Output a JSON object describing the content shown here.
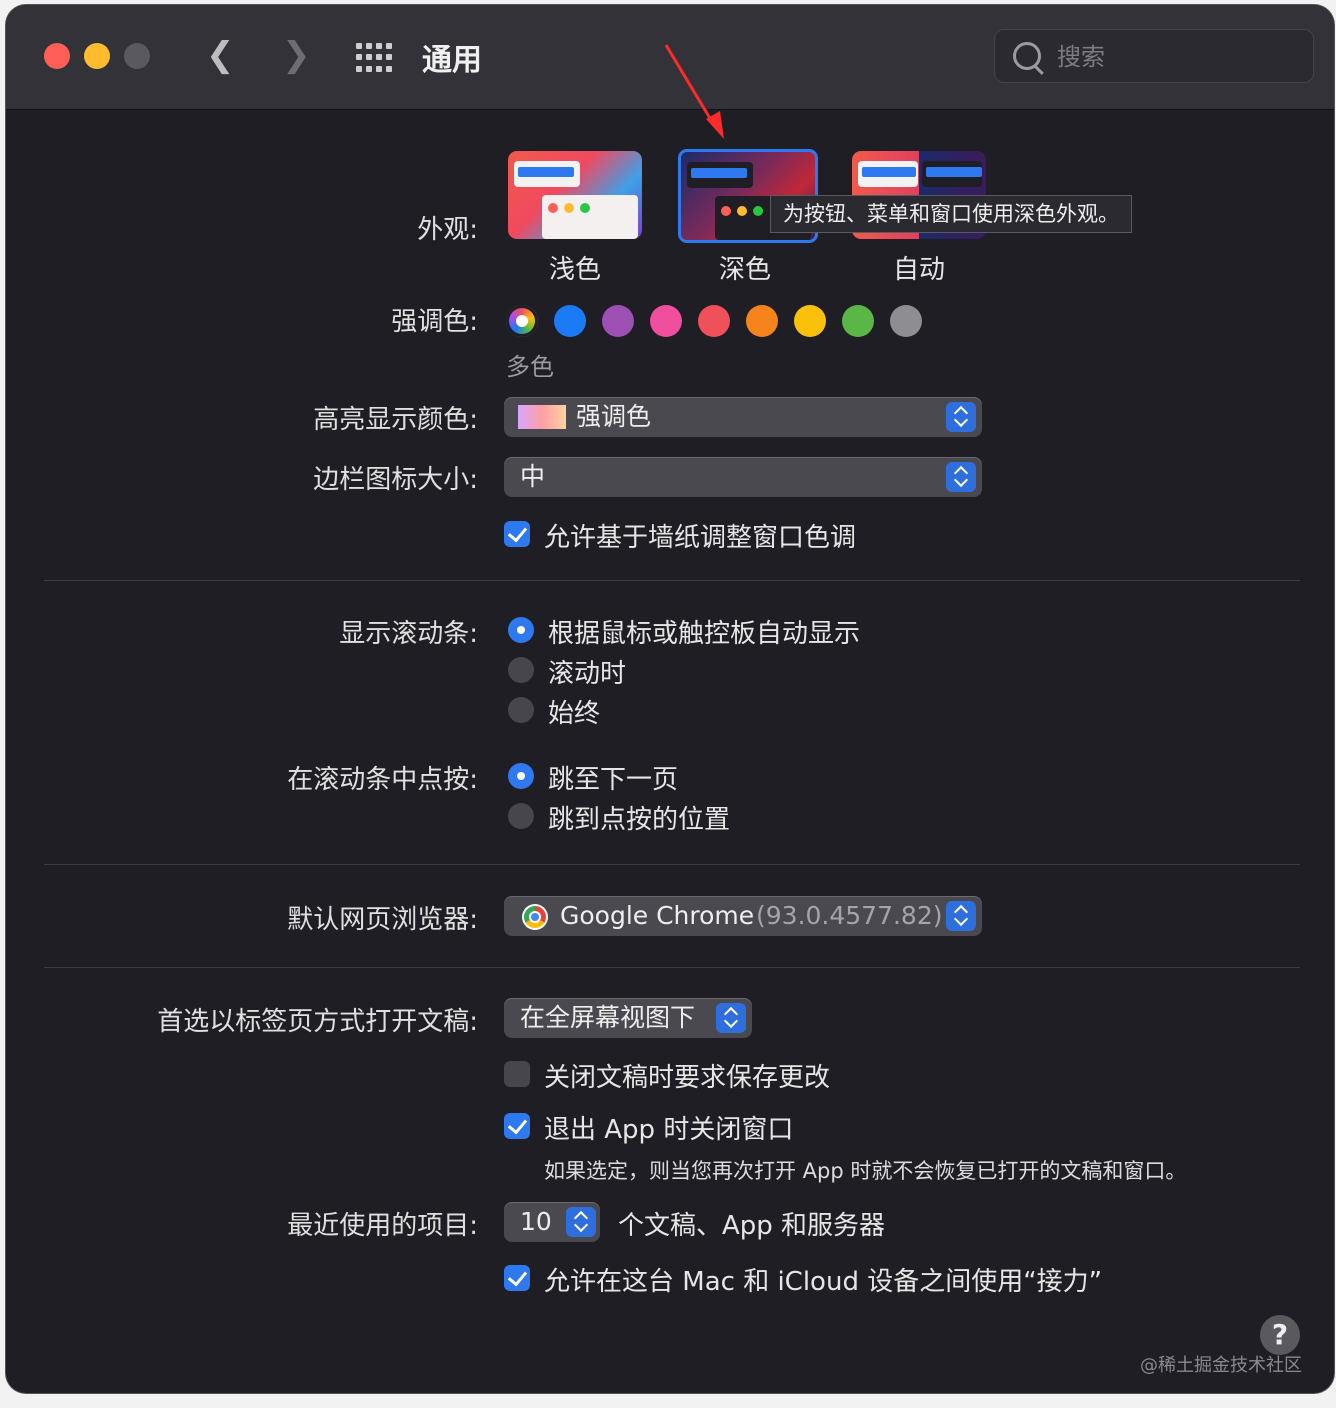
{
  "window": {
    "title": "通用",
    "search_placeholder": "搜索"
  },
  "appearance": {
    "label": "外观:",
    "options": [
      "浅色",
      "深色",
      "自动"
    ],
    "selected": "深色",
    "tooltip": "为按钮、菜单和窗口使用深色外观。"
  },
  "accent": {
    "label": "强调色:",
    "caption": "多色",
    "colors": [
      "#a64cf0",
      "#1a7bf5",
      "#9e4fb4",
      "#ef4f9c",
      "#f0505a",
      "#f7831c",
      "#fbc10a",
      "#5bb745",
      "#8e8e92"
    ]
  },
  "highlight": {
    "label": "高亮显示颜色:",
    "value": "强调色"
  },
  "sidebar_icon": {
    "label": "边栏图标大小:",
    "value": "中"
  },
  "wallpaper_tint": {
    "label": "允许基于墙纸调整窗口色调",
    "checked": true
  },
  "scrollbars": {
    "label": "显示滚动条:",
    "options": [
      "根据鼠标或触控板自动显示",
      "滚动时",
      "始终"
    ],
    "selected": 0
  },
  "click_scrollbar": {
    "label": "在滚动条中点按:",
    "options": [
      "跳至下一页",
      "跳到点按的位置"
    ],
    "selected": 0
  },
  "browser": {
    "label": "默认网页浏览器:",
    "name": "Google Chrome",
    "version": "(93.0.4577.82)"
  },
  "tabs": {
    "label": "首选以标签页方式打开文稿:",
    "value": "在全屏幕视图下"
  },
  "ask_save": {
    "label": "关闭文稿时要求保存更改",
    "checked": false
  },
  "close_windows": {
    "label": "退出 App 时关闭窗口",
    "checked": true,
    "hint": "如果选定，则当您再次打开 App 时就不会恢复已打开的文稿和窗口。"
  },
  "recent": {
    "label": "最近使用的项目:",
    "value": "10",
    "suffix": "个文稿、App 和服务器"
  },
  "handoff": {
    "label": "允许在这台 Mac 和 iCloud 设备之间使用“接力”",
    "checked": true
  },
  "help": "?",
  "watermark": "@稀土掘金技术社区"
}
